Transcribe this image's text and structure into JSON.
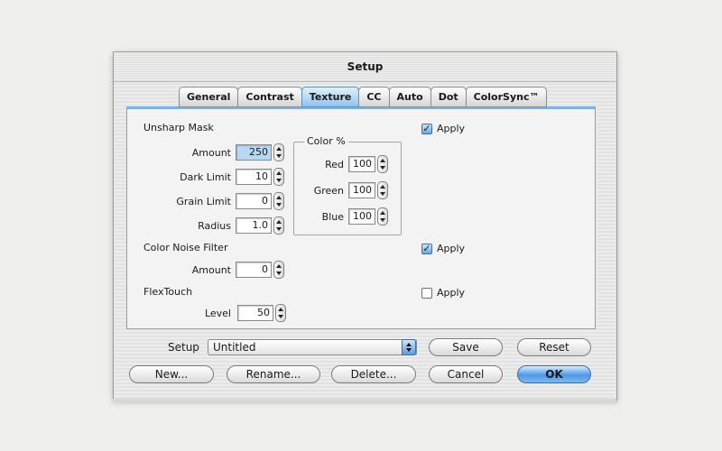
{
  "window": {
    "title": "Setup"
  },
  "tabs": [
    {
      "label": "General",
      "active": false
    },
    {
      "label": "Contrast",
      "active": false
    },
    {
      "label": "Texture",
      "active": true
    },
    {
      "label": "CC",
      "active": false
    },
    {
      "label": "Auto",
      "active": false
    },
    {
      "label": "Dot",
      "active": false
    },
    {
      "label": "ColorSync™",
      "active": false
    }
  ],
  "unsharp_mask": {
    "title": "Unsharp Mask",
    "apply_label": "Apply",
    "apply_checked": true,
    "amount": {
      "label": "Amount",
      "value": "250"
    },
    "dark_limit": {
      "label": "Dark Limit",
      "value": "10"
    },
    "grain_limit": {
      "label": "Grain Limit",
      "value": "0"
    },
    "radius": {
      "label": "Radius",
      "value": "1.0"
    },
    "color_pct": {
      "title": "Color %",
      "red": {
        "label": "Red",
        "value": "100"
      },
      "green": {
        "label": "Green",
        "value": "100"
      },
      "blue": {
        "label": "Blue",
        "value": "100"
      }
    }
  },
  "color_noise_filter": {
    "title": "Color Noise Filter",
    "apply_label": "Apply",
    "apply_checked": true,
    "amount": {
      "label": "Amount",
      "value": "0"
    }
  },
  "flextouch": {
    "title": "FlexTouch",
    "apply_label": "Apply",
    "apply_checked": false,
    "level": {
      "label": "Level",
      "value": "50"
    }
  },
  "footer": {
    "setup_label": "Setup",
    "setup_value": "Untitled",
    "save": "Save",
    "reset": "Reset",
    "new": "New...",
    "rename": "Rename...",
    "delete": "Delete...",
    "cancel": "Cancel",
    "ok": "OK"
  },
  "colors": {
    "accent": "#4f99e6",
    "tab_active": "#8fc3ee"
  }
}
